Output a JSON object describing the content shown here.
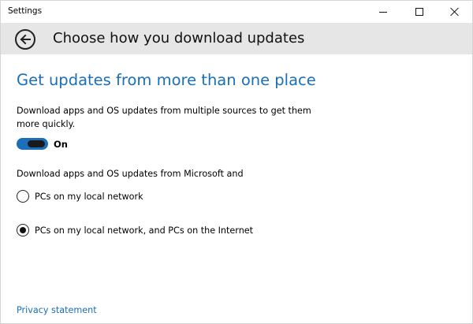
{
  "window": {
    "title": "Settings"
  },
  "header": {
    "page_title": "Choose how you download updates"
  },
  "content": {
    "section_title": "Get updates from more than one place",
    "description": "Download apps and OS updates from multiple sources to get them more quickly.",
    "toggle": {
      "state_label": "On",
      "is_on": true
    },
    "sub_description": "Download apps and OS updates from Microsoft and",
    "options": [
      {
        "label": "PCs on my local network",
        "selected": false
      },
      {
        "label": "PCs on my local network, and PCs on the Internet",
        "selected": true
      }
    ],
    "privacy_link": "Privacy statement"
  },
  "colors": {
    "accent": "#1a6fb8",
    "header_bg": "#e6e6e6"
  },
  "icons": {
    "back": "back-arrow-icon",
    "minimize": "minimize-icon",
    "maximize": "maximize-icon",
    "close": "close-icon"
  }
}
